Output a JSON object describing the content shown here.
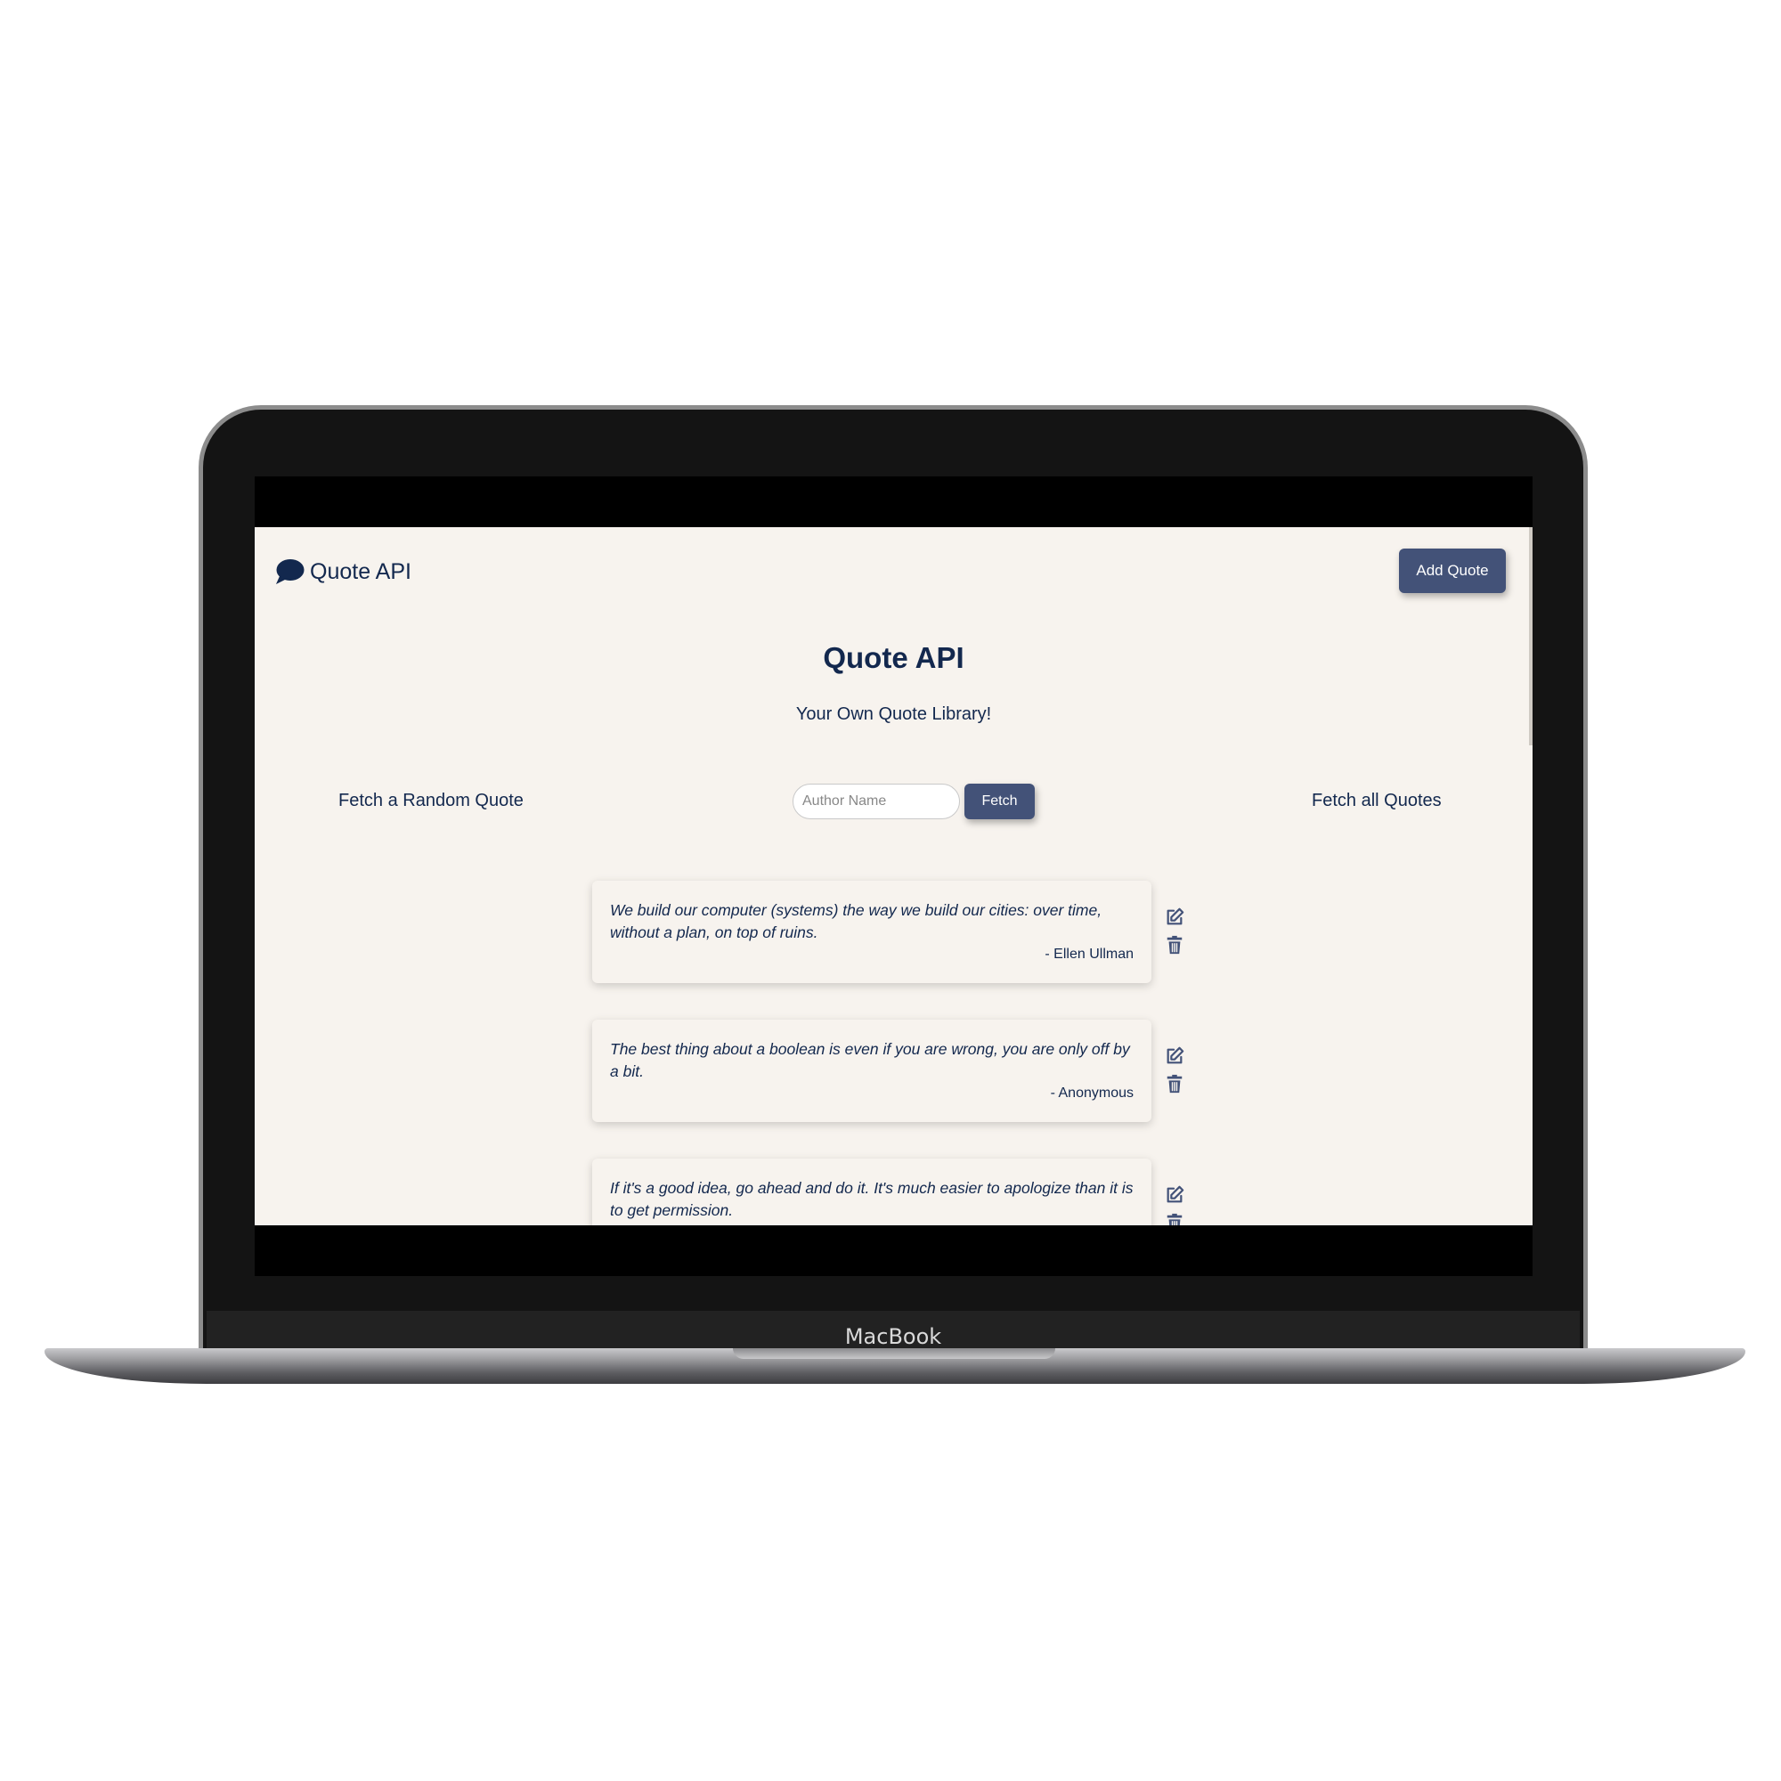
{
  "device": {
    "label": "MacBook"
  },
  "nav": {
    "brand": "Quote API",
    "brand_icon": "speech-bubble-icon",
    "add_quote_label": "Add Quote"
  },
  "hero": {
    "title": "Quote API",
    "subtitle": "Your Own Quote Library!"
  },
  "controls": {
    "random_label": "Fetch a Random Quote",
    "all_label": "Fetch all Quotes",
    "author_placeholder": "Author Name",
    "fetch_label": "Fetch"
  },
  "quotes": [
    {
      "text": "We build our computer (systems) the way we build our cities: over time, without a plan, on top of ruins.",
      "author": "- Ellen Ullman"
    },
    {
      "text": "The best thing about a boolean is even if you are wrong, you are only off by a bit.",
      "author": "- Anonymous"
    },
    {
      "text": "If it's a good idea, go ahead and do it. It's much easier to apologize than it is to get permission.",
      "author": ""
    }
  ],
  "colors": {
    "primary": "#13284e",
    "button": "#435278",
    "background": "#f7f3ee"
  }
}
